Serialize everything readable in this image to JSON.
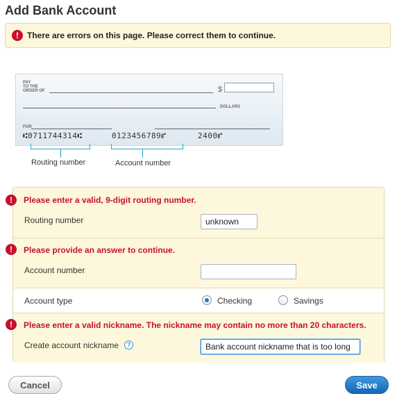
{
  "header": {
    "title": "Add Bank Account"
  },
  "page_error": {
    "message": "There are errors on this page. Please correct them to continue.",
    "icon": "error-icon"
  },
  "check": {
    "pay_to_the": "PAY",
    "to_the": "TO THE",
    "order_of": "ORDER OF",
    "dollar_sign": "$",
    "dollars": "DOLLARS",
    "for": "FOR",
    "micr_routing": "⑆0711744314⑆",
    "micr_account": "0123456789⑈",
    "micr_check": "2400⑈",
    "routing_label": "Routing number",
    "account_label": "Account number"
  },
  "form": {
    "routing": {
      "error": "Please enter a valid, 9-digit routing number.",
      "label": "Routing number",
      "value": "unknown"
    },
    "account": {
      "error": "Please provide an answer to continue.",
      "label": "Account number",
      "value": ""
    },
    "account_type": {
      "label": "Account type",
      "options": [
        "Checking",
        "Savings"
      ],
      "selected": "Checking"
    },
    "nickname": {
      "error": "Please enter a valid nickname. The nickname may contain no more than 20 characters.",
      "label": "Create account nickname",
      "help": "?",
      "value": "Bank account nickname that is too long"
    }
  },
  "actions": {
    "cancel_label": "Cancel",
    "save_label": "Save"
  },
  "colors": {
    "error": "#c8102e",
    "accent": "#1f7fc6",
    "error_bg": "#fdf8dc"
  }
}
